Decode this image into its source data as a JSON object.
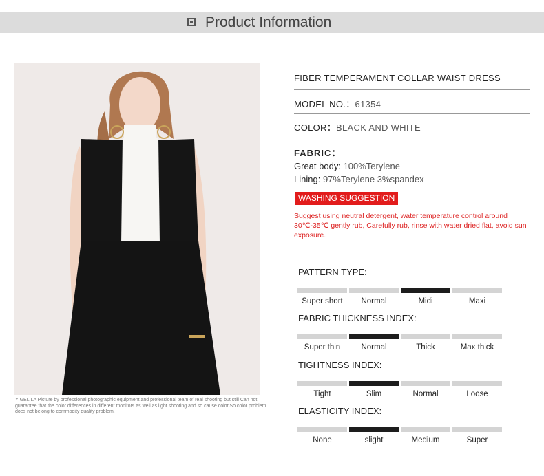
{
  "header": {
    "title": "Product Information",
    "icon": "plus-square-icon"
  },
  "product": {
    "name": "FIBER TEMPERAMENT COLLAR WAIST DRESS",
    "model_label": "MODEL NO.：",
    "model_value": "61354",
    "color_label": "COLOR：",
    "color_value": "BLACK AND WHITE",
    "fabric_label": "FABRIC：",
    "great_body_label": "Great body:",
    "great_body_value": "100%Terylene",
    "lining_label": "Lining:",
    "lining_value": "97%Terylene 3%spandex"
  },
  "washing": {
    "badge": "WASHING SUGGESTION",
    "text": "Suggest using neutral detergent, water temperature control around 30℃-35℃ gently rub, Carefully rub, rinse with water dried flat, avoid sun exposure.",
    "color": "#e21c1c"
  },
  "photo_caption": "YIGELILA Picture by professional photographic equipment and professional team of real shooting but still Can not guarantee that the color differences in different monitors as well as light shooting and so cause color,So color problem does not belong to commodity quality problem.",
  "indices": [
    {
      "title": "PATTERN TYPE:",
      "options": [
        "Super short",
        "Normal",
        "Midi",
        "Maxi"
      ],
      "selected": "Midi"
    },
    {
      "title": "FABRIC THICKNESS INDEX:",
      "options": [
        "Super thin",
        "Normal",
        "Thick",
        "Max thick"
      ],
      "selected": "Normal"
    },
    {
      "title": "TIGHTNESS INDEX:",
      "options": [
        "Tight",
        "Slim",
        "Normal",
        "Loose"
      ],
      "selected": "Slim"
    },
    {
      "title": "ELASTICITY INDEX:",
      "options": [
        "None",
        "slight",
        "Medium",
        "Super"
      ],
      "selected": "slight"
    }
  ]
}
